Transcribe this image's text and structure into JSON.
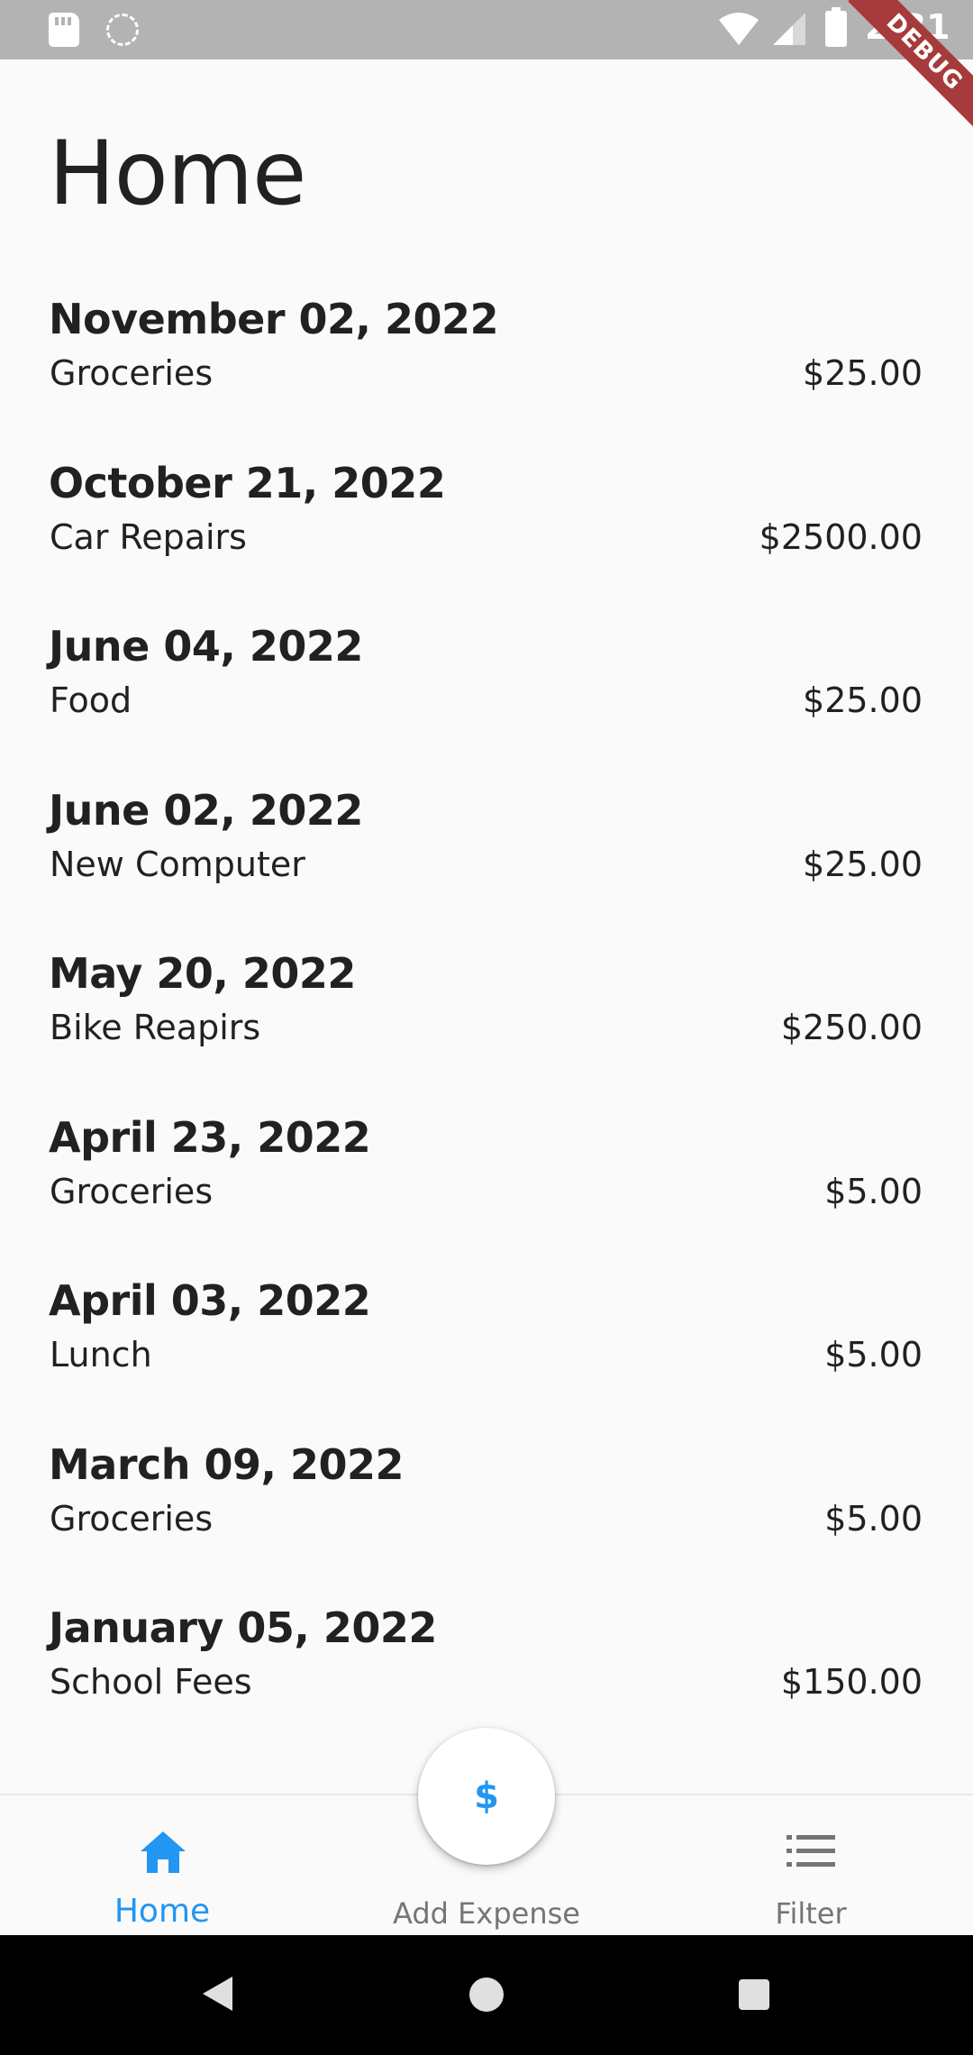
{
  "status_bar": {
    "time": "2:31"
  },
  "debug_banner": "DEBUG",
  "page": {
    "title": "Home"
  },
  "expenses": [
    {
      "date": "November 02, 2022",
      "name": "Groceries",
      "amount": "$25.00"
    },
    {
      "date": "October 21, 2022",
      "name": "Car Repairs",
      "amount": "$2500.00"
    },
    {
      "date": "June 04, 2022",
      "name": "Food",
      "amount": "$25.00"
    },
    {
      "date": "June 02, 2022",
      "name": "New Computer",
      "amount": "$25.00"
    },
    {
      "date": "May 20, 2022",
      "name": "Bike Reapirs",
      "amount": "$250.00"
    },
    {
      "date": "April 23, 2022",
      "name": "Groceries",
      "amount": "$5.00"
    },
    {
      "date": "April 03, 2022",
      "name": "Lunch",
      "amount": "$5.00"
    },
    {
      "date": "March 09, 2022",
      "name": "Groceries",
      "amount": "$5.00"
    },
    {
      "date": "January 05, 2022",
      "name": "School Fees",
      "amount": "$150.00"
    }
  ],
  "bottom_nav": {
    "items": [
      {
        "label": "Home",
        "icon": "home-icon",
        "active": true
      },
      {
        "label": "Add Expense",
        "icon": "",
        "active": false
      },
      {
        "label": "Filter",
        "icon": "list-icon",
        "active": false
      }
    ]
  },
  "fab": {
    "symbol": "$"
  },
  "colors": {
    "accent": "#2196f3",
    "inactive": "#757575",
    "text": "#212121",
    "background": "#fafafa"
  }
}
